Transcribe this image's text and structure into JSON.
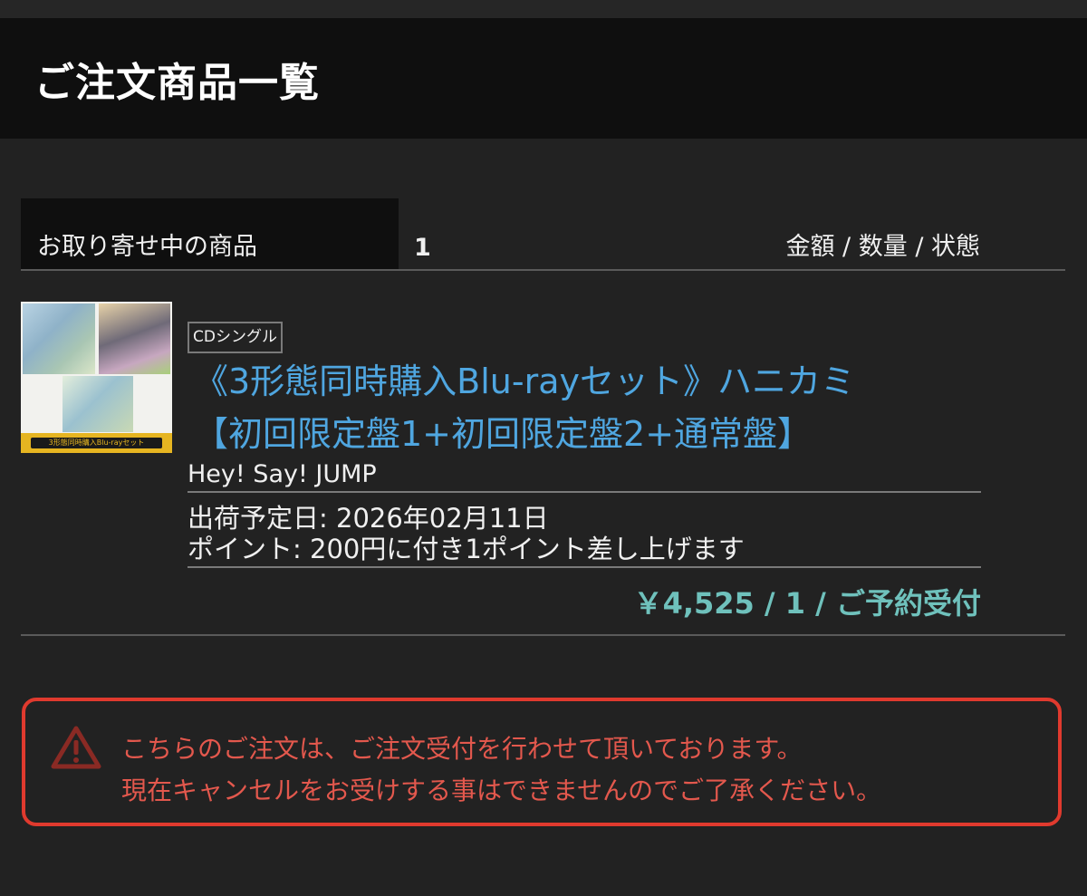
{
  "header": {
    "title": "ご注文商品一覧"
  },
  "list": {
    "tab_label": "お取り寄せ中の商品",
    "count": "1",
    "columns_label": "金額 / 数量 / 状態"
  },
  "item": {
    "thumbnail_caption": "3形態同時購入Blu-rayセット",
    "category_badge": "CDシングル",
    "title_line1": "《3形態同時購入Blu-rayセット》ハニカミ",
    "title_line2": "【初回限定盤1+初回限定盤2+通常盤】",
    "artist": "Hey! Say! JUMP",
    "ship_date": "出荷予定日: 2026年02月11日",
    "points": "ポイント: 200円に付き1ポイント差し上げます",
    "price_qty_status": "￥4,525 / 1 / ご予約受付"
  },
  "notice": {
    "icon": "warning-icon",
    "line1": "こちらのご注文は、ご注文受付を行わせて頂いております。",
    "line2": "現在キャンセルをお受けする事はできませんのでご了承ください。"
  },
  "colors": {
    "background": "#222222",
    "header_bg": "#0f0f0f",
    "link": "#4fa6e0",
    "price": "#6fc1bc",
    "alert": "#e03a2e"
  }
}
